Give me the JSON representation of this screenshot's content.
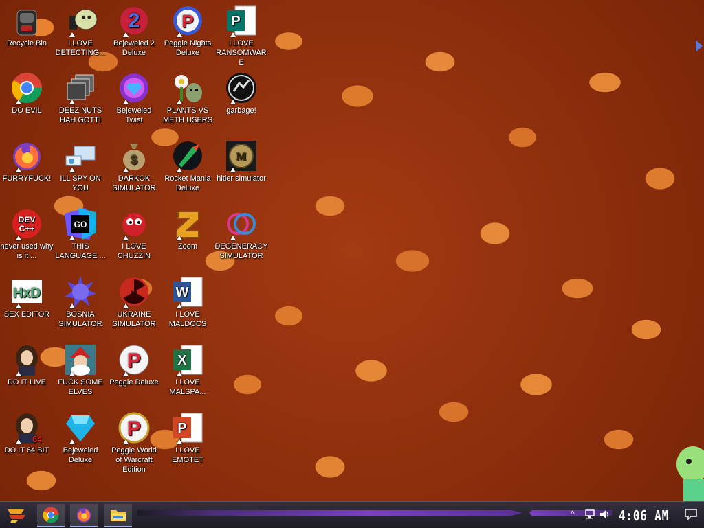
{
  "desktop": {
    "icons": [
      {
        "label": "Recycle Bin",
        "icon": "recycle-bin-icon",
        "shortcut": false
      },
      {
        "label": "I LOVE DETECTING...",
        "icon": "detective-game-icon",
        "shortcut": true
      },
      {
        "label": "Bejeweled 2 Deluxe",
        "icon": "bejeweled2-icon",
        "shortcut": true
      },
      {
        "label": "Peggle Nights Deluxe",
        "icon": "peggle-nights-icon",
        "shortcut": true
      },
      {
        "label": "I LOVE RANSOMWARE",
        "icon": "publisher-icon",
        "shortcut": true
      },
      {
        "label": "DO EVIL",
        "icon": "chrome-icon",
        "shortcut": true
      },
      {
        "label": "DEEZ NUTS HAH GOTTI",
        "icon": "windows-stack-icon",
        "shortcut": true
      },
      {
        "label": "Bejeweled Twist",
        "icon": "bejeweled-twist-icon",
        "shortcut": true
      },
      {
        "label": "PLANTS VS METH USERS",
        "icon": "plants-vs-zombies-icon",
        "shortcut": true
      },
      {
        "label": "garbage!",
        "icon": "paradox-launcher-icon",
        "shortcut": true
      },
      {
        "label": "FURRYFUCK!",
        "icon": "firefox-icon",
        "shortcut": true
      },
      {
        "label": "ILL SPY ON YOU",
        "icon": "remote-desktop-icon",
        "shortcut": true
      },
      {
        "label": "DARKOK SIMULATOR",
        "icon": "money-bag-icon",
        "shortcut": true
      },
      {
        "label": "Rocket Mania Deluxe",
        "icon": "rocket-mania-icon",
        "shortcut": true
      },
      {
        "label": "hitler simulator",
        "icon": "hoi-icon",
        "shortcut": true
      },
      {
        "label": "never used why is it ...",
        "icon": "devcpp-icon",
        "shortcut": true
      },
      {
        "label": "THIS LANGUAGE ...",
        "icon": "goland-icon",
        "shortcut": true
      },
      {
        "label": "I LOVE CHUZZIN",
        "icon": "chuzzle-icon",
        "shortcut": true
      },
      {
        "label": "Zoom",
        "icon": "zuma-icon",
        "shortcut": true
      },
      {
        "label": "DEGENERACY SIMULATOR",
        "icon": "game-logo-icon",
        "shortcut": true
      },
      {
        "label": "SEX EDITOR",
        "icon": "hxd-icon",
        "shortcut": true
      },
      {
        "label": "BOSNIA SIMULATOR",
        "icon": "spiky-ball-icon",
        "shortcut": true
      },
      {
        "label": "UKRAINE SIMULATOR",
        "icon": "radiation-icon",
        "shortcut": true
      },
      {
        "label": "I LOVE MALDOCS",
        "icon": "word-icon",
        "shortcut": true
      },
      {
        "label": "DO IT LIVE",
        "icon": "portrait-icon",
        "shortcut": true
      },
      {
        "label": "FUCK SOME ELVES",
        "icon": "santa-icon",
        "shortcut": true
      },
      {
        "label": "Peggle Deluxe",
        "icon": "peggle-icon",
        "shortcut": true
      },
      {
        "label": "I LOVE MALSPA...",
        "icon": "excel-icon",
        "shortcut": true
      },
      {
        "label": "DO IT 64 BIT",
        "icon": "portrait-64-icon",
        "shortcut": true
      },
      {
        "label": "Bejeweled Deluxe",
        "icon": "diamond-icon",
        "shortcut": true
      },
      {
        "label": "Peggle World of Warcraft Edition",
        "icon": "peggle-wow-icon",
        "shortcut": true
      },
      {
        "label": "I LOVE EMOTET",
        "icon": "powerpoint-icon",
        "shortcut": true
      }
    ]
  },
  "taskbar": {
    "start": "start-icon",
    "apps": [
      {
        "name": "chrome",
        "icon": "chrome-icon"
      },
      {
        "name": "firefox",
        "icon": "firefox-icon"
      },
      {
        "name": "file-explorer",
        "icon": "folder-icon"
      }
    ],
    "tray": {
      "chevron": "^",
      "clock": "4:06 AM"
    }
  },
  "colors": {
    "taskbar": "#26232e",
    "accent_purple": "#7a3fc2",
    "label_text": "#ffffff"
  }
}
